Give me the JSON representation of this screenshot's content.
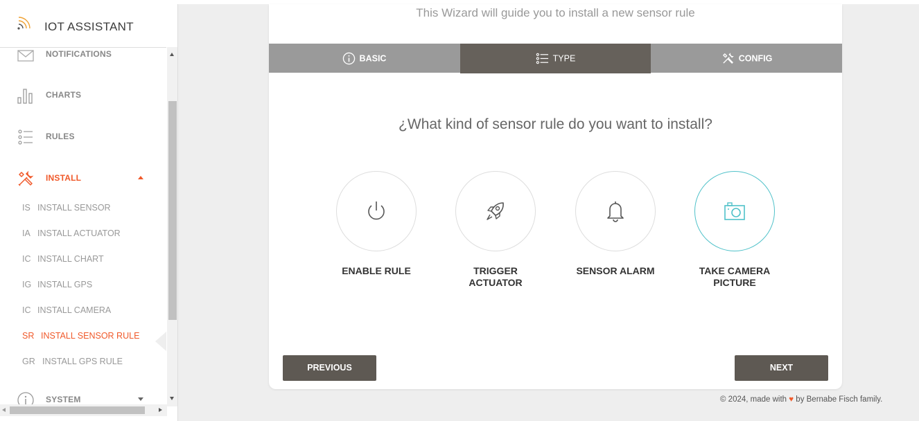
{
  "app": {
    "title": "IOT ASSISTANT"
  },
  "sidebar": {
    "items": [
      {
        "label": "NOTIFICATIONS",
        "icon": "envelope-icon"
      },
      {
        "label": "CHARTS",
        "icon": "bar-chart-icon"
      },
      {
        "label": "RULES",
        "icon": "list-icon"
      },
      {
        "label": "INSTALL",
        "icon": "tools-icon",
        "active": true
      },
      {
        "label": "SYSTEM",
        "icon": "info-icon"
      }
    ],
    "install_sub": [
      {
        "abbr": "IS",
        "label": "INSTALL SENSOR"
      },
      {
        "abbr": "IA",
        "label": "INSTALL ACTUATOR"
      },
      {
        "abbr": "IC",
        "label": "INSTALL CHART"
      },
      {
        "abbr": "IG",
        "label": "INSTALL GPS"
      },
      {
        "abbr": "IC",
        "label": "INSTALL CAMERA"
      },
      {
        "abbr": "SR",
        "label": "INSTALL SENSOR RULE",
        "active": true
      },
      {
        "abbr": "GR",
        "label": "INSTALL GPS RULE"
      }
    ]
  },
  "wizard": {
    "subtitle": "This Wizard will guide you to install a new sensor rule",
    "tabs": [
      {
        "label": "BASIC",
        "icon": "info-icon"
      },
      {
        "label": "TYPE",
        "icon": "list-icon",
        "active": true
      },
      {
        "label": "CONFIG",
        "icon": "tools-icon"
      }
    ],
    "question": "¿What kind of sensor rule do you want to install?",
    "options": [
      {
        "line1": "ENABLE RULE",
        "line2": "",
        "icon": "power-icon"
      },
      {
        "line1": "TRIGGER",
        "line2": "ACTUATOR",
        "icon": "rocket-icon"
      },
      {
        "line1": "SENSOR ALARM",
        "line2": "",
        "icon": "bell-icon"
      },
      {
        "line1": "TAKE CAMERA",
        "line2": "PICTURE",
        "icon": "camera-icon",
        "selected": true
      }
    ],
    "previous_label": "PREVIOUS",
    "next_label": "NEXT"
  },
  "footer": {
    "prefix": "© 2024, made with",
    "heart": "♥",
    "suffix": "by Bernabe Fisch family."
  },
  "colors": {
    "accent": "#f0592a",
    "selected": "#4fc1c9",
    "tab_active": "#66615b",
    "tab_bg": "#9a9a9a",
    "button": "#5e5953"
  }
}
